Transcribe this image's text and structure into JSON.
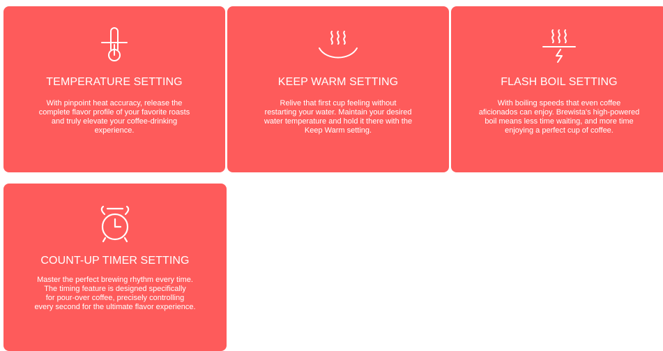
{
  "cards": [
    {
      "title": "TEMPERATURE SETTING",
      "icon": "thermometer-icon",
      "lines": [
        "With pinpoint heat accuracy, release the",
        "complete flavor profile of your favorite roasts",
        "and truly elevate your coffee-drinking",
        "experience."
      ]
    },
    {
      "title": "KEEP WARM SETTING",
      "icon": "steaming-cup-icon",
      "lines": [
        "Relive that first cup feeling without",
        "restarting your water. Maintain your desired",
        "water temperature and hold it there with the",
        "Keep Warm setting."
      ]
    },
    {
      "title": "FLASH BOIL SETTING",
      "icon": "flash-boil-icon",
      "lines": [
        "With boiling speeds that even coffee",
        "aficionados can enjoy. Brewista's high-powered",
        "boil means less time waiting, and more time",
        "enjoying a perfect cup of coffee."
      ]
    },
    {
      "title": "COUNT-UP TIMER SETTING",
      "icon": "alarm-clock-icon",
      "lines": [
        "Master the perfect brewing rhythm every time.",
        "The timing feature is designed specifically",
        "for pour-over coffee, precisely controlling",
        "every second for the ultimate flavor experience."
      ]
    }
  ],
  "colors": {
    "card_background": "#fe5b5b",
    "text": "#ffffff",
    "page_background": "#ffffff"
  }
}
